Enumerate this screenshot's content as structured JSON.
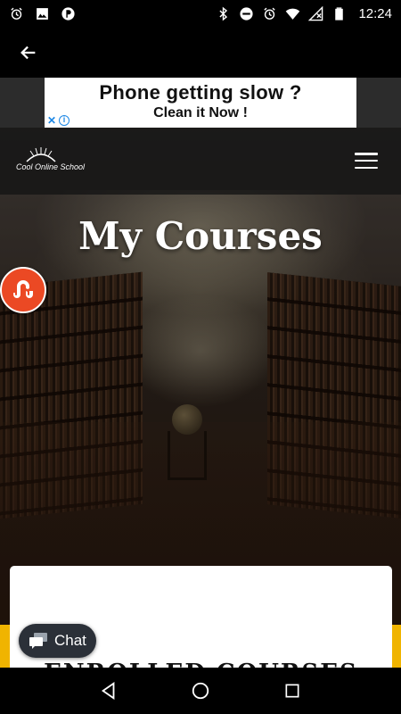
{
  "status_bar": {
    "time": "12:24",
    "left_icons": [
      "alarm-icon",
      "image-icon",
      "p-app-icon"
    ],
    "right_icons": [
      "bluetooth-icon",
      "dnd-icon",
      "alarm-icon",
      "wifi-icon",
      "no-signal-icon",
      "battery-icon"
    ]
  },
  "app_bar": {
    "back_icon": "arrow-left-icon"
  },
  "ad": {
    "title": "Phone getting slow ?",
    "subtitle": "Clean it Now !",
    "close_glyph": "✕",
    "info_glyph": "i"
  },
  "header": {
    "logo_text": "Cool Online School",
    "menu_icon": "hamburger-menu-icon"
  },
  "hero": {
    "title": "My Courses"
  },
  "share": {
    "icon": "stumbleupon-icon",
    "color": "#eb4924"
  },
  "card": {
    "peek_text": "ENROLLED COURSES"
  },
  "chat": {
    "label": "Chat"
  },
  "nav": {
    "icons": [
      "back-triangle-icon",
      "home-circle-icon",
      "recents-square-icon"
    ]
  },
  "colors": {
    "accent_gold": "#f0b400",
    "chat_bg": "#2b3038"
  }
}
